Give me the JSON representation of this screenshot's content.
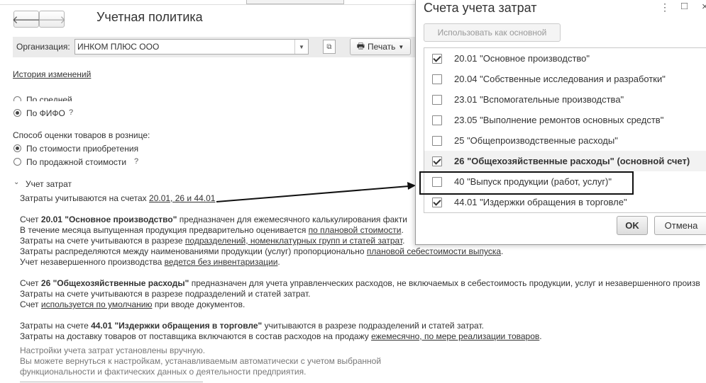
{
  "page": {
    "title": "Учетная политика"
  },
  "nav": {
    "back_glyph": "🡐",
    "forward_glyph": "🡒"
  },
  "org": {
    "label": "Организация:",
    "value": "ИНКОМ ПЛЮС ООО"
  },
  "print": {
    "label": "Печать"
  },
  "history_link": "История изменений",
  "inventory": {
    "opt_avg_partial": "По средней",
    "opt_fifo": "По ФИФО",
    "help": "?"
  },
  "retail": {
    "label": "Способ оценки товаров в рознице:",
    "opt_cost": "По стоимости приобретения",
    "opt_sale": "По продажной стоимости",
    "help": "?"
  },
  "costs": {
    "section_title": "Учет затрат",
    "accounts_prefix": "Затраты учитываются на счетах",
    "accounts_link": "20.01, 26 и 44.01",
    "p1": {
      "l1_pre": "Счет ",
      "l1_bold": "20.01 \"Основное производство\"",
      "l1_rest": " предназначен для ежемесячного калькулирования факти",
      "l2_pre": "В течение месяца выпущенная продукция предварительно оценивается ",
      "l2_link": "по плановой стоимости",
      "l2_post": ".",
      "l3_pre": "Затраты на счете учитываются в разрезе ",
      "l3_link": "подразделений, номенклатурных групп и статей затрат",
      "l3_post": ".",
      "l4_pre": "Затраты распределяются между наименованиями продукции (услуг) пропорционально ",
      "l4_link": "плановой себестоимости выпуска",
      "l4_post": ".",
      "l5_pre": "Учет незавершенного производства ",
      "l5_link": "ведется без инвентаризации",
      "l5_post": "."
    },
    "p2": {
      "l1_pre": "Счет ",
      "l1_bold": "26 \"Общехозяйственные расходы\"",
      "l1_rest": " предназначен для учета управленческих расходов, не включаемых в себестоимость продукции, услуг и незавершенного произв",
      "l2": "Затраты на счете учитываются в разрезе подразделений и статей затрат.",
      "l3_pre": "Счет ",
      "l3_link": "используется по умолчанию",
      "l3_post": " при вводе документов."
    },
    "p3": {
      "l1_pre": "Затраты на счете ",
      "l1_bold": "44.01 \"Издержки обращения в торговле\"",
      "l1_rest": " учитываются в разрезе подразделений и статей затрат.",
      "l2_pre": "Затраты на доставку товаров от поставщика включаются в состав расходов на продажу ",
      "l2_link": "ежемесячно, по мере реализации товаров",
      "l2_post": "."
    },
    "note": {
      "l1": "Настройки учета затрат установлены вручную.",
      "l2": "Вы можете вернуться к настройкам, устанавливаемым автоматически с учетом выбранной",
      "l3": "функциональности и фактических данных о деятельности предприятия."
    }
  },
  "dialog": {
    "title": "Счета учета затрат",
    "use_main_button": "Использовать как основной",
    "ok": "OK",
    "cancel": "Отмена",
    "accounts": [
      {
        "label": "20.01 \"Основное производство\"",
        "checked": true
      },
      {
        "label": "20.04 \"Собственные исследования и разработки\"",
        "checked": false
      },
      {
        "label": "23.01 \"Вспомогательные производства\"",
        "checked": false
      },
      {
        "label": "23.05 \"Выполнение ремонтов основных средств\"",
        "checked": false
      },
      {
        "label": "25 \"Общепроизводственные расходы\"",
        "checked": false
      },
      {
        "label": "26 \"Общехозяйственные расходы\" (основной счет)",
        "checked": true,
        "selected": true
      },
      {
        "label": "40 \"Выпуск продукции (работ, услуг)\"",
        "checked": false
      },
      {
        "label": "44.01 \"Издержки обращения в торговле\"",
        "checked": true
      }
    ]
  }
}
